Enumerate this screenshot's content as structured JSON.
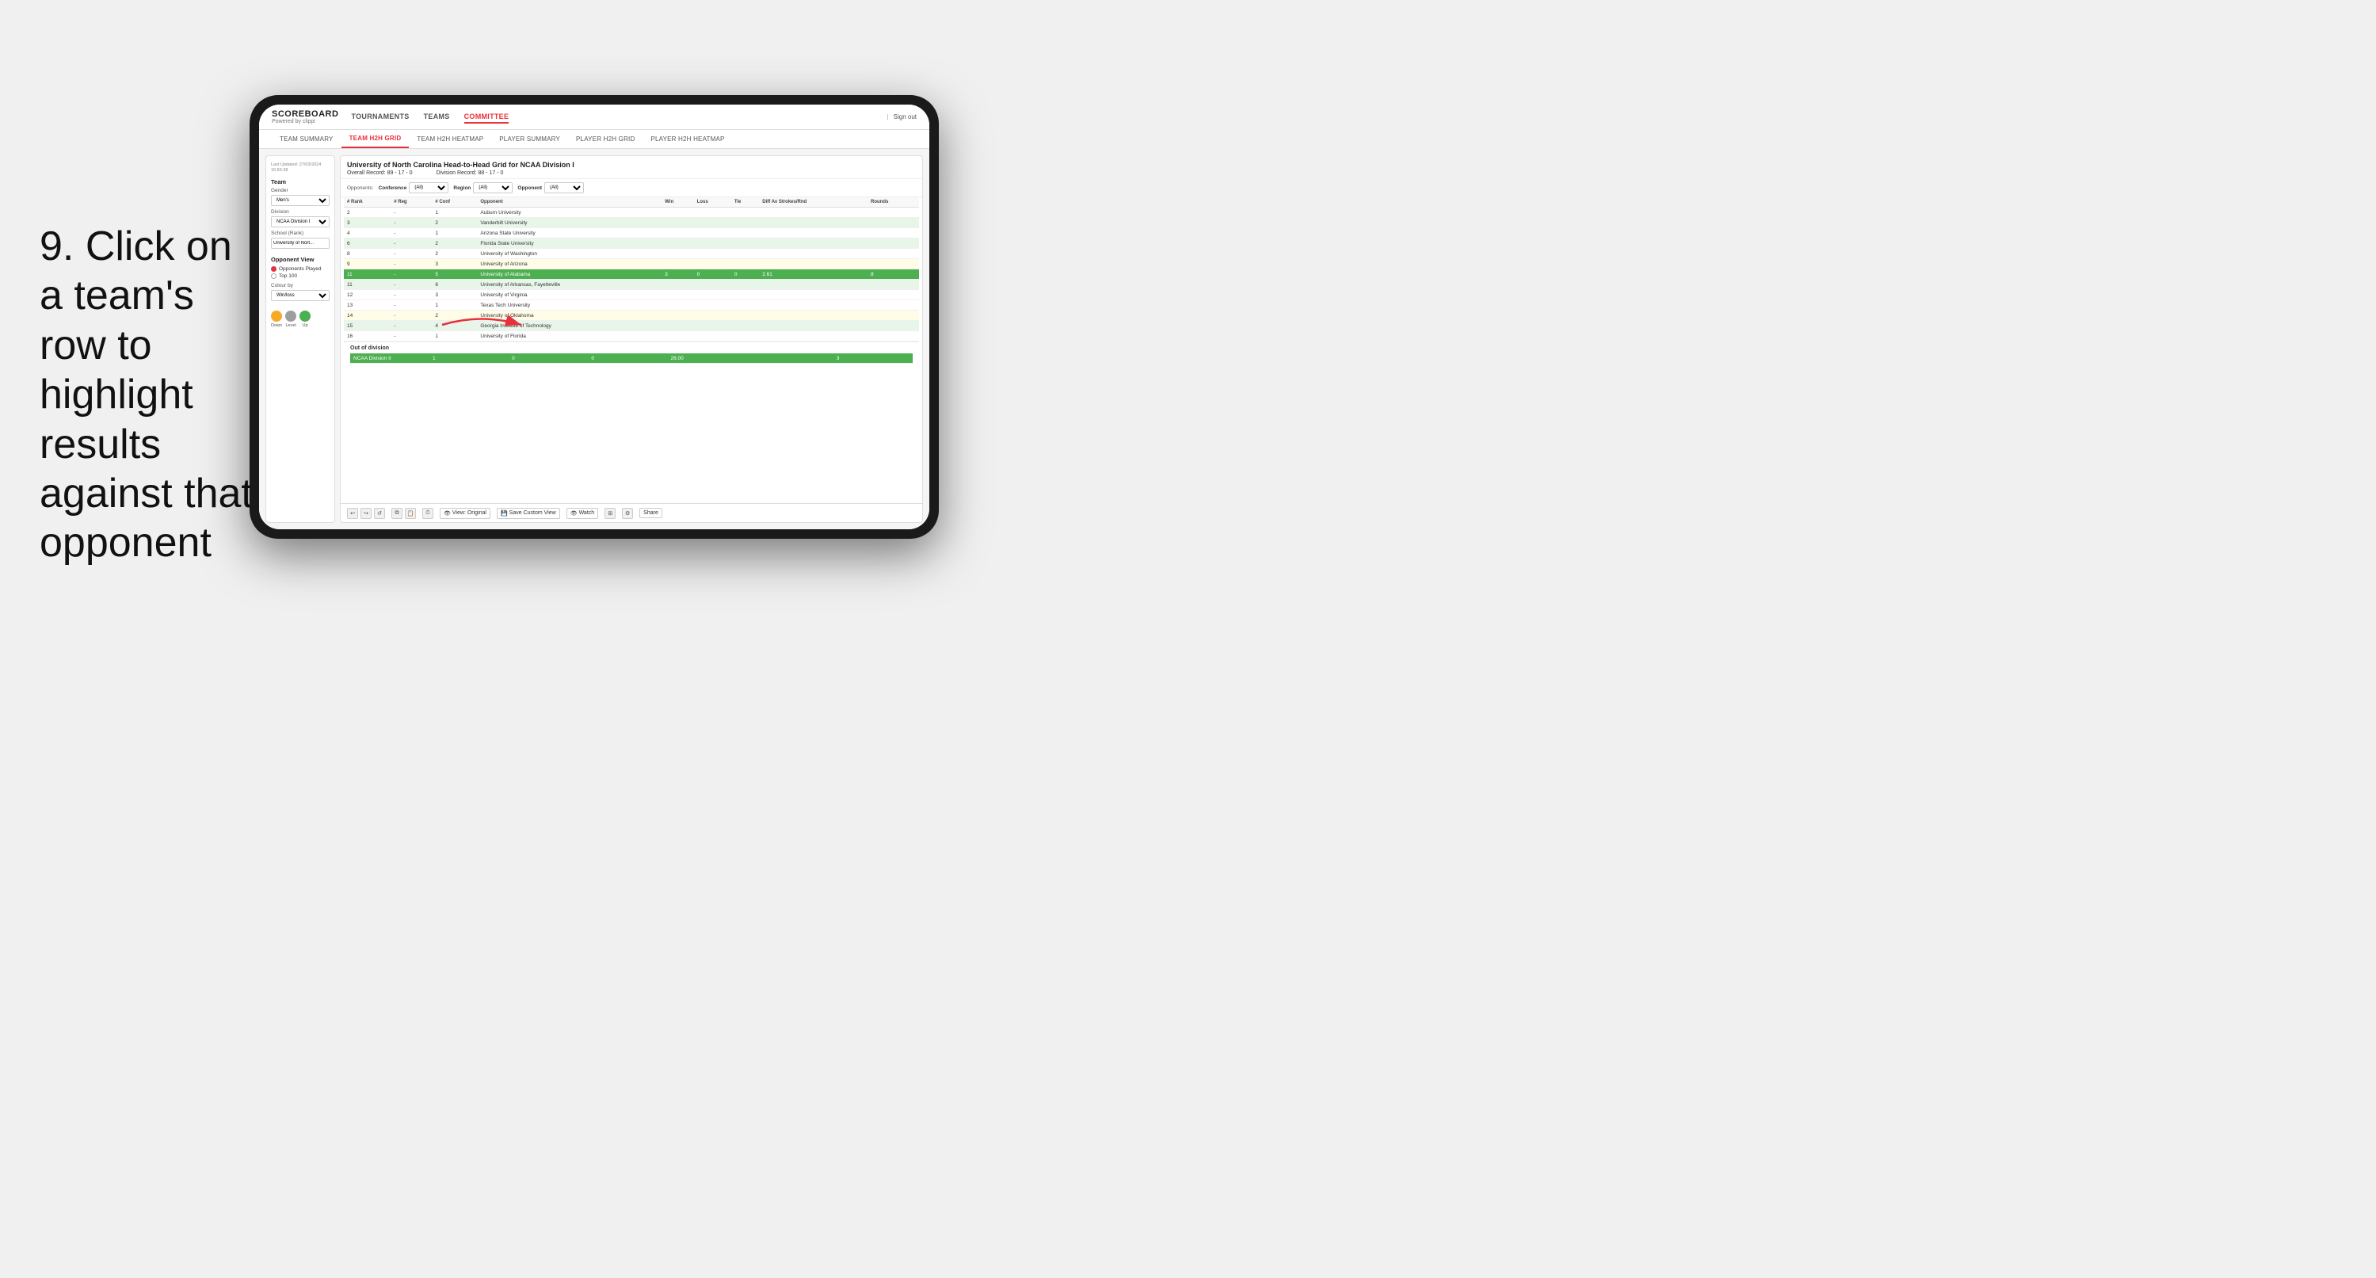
{
  "instruction": {
    "step": "9.",
    "text": "Click on a team's row to highlight results against that opponent"
  },
  "nav": {
    "logo": "SCOREBOARD",
    "logo_sub": "Powered by clippi",
    "items": [
      "TOURNAMENTS",
      "TEAMS",
      "COMMITTEE"
    ],
    "sign_out": "Sign out"
  },
  "sub_nav": {
    "items": [
      "TEAM SUMMARY",
      "TEAM H2H GRID",
      "TEAM H2H HEATMAP",
      "PLAYER SUMMARY",
      "PLAYER H2H GRID",
      "PLAYER H2H HEATMAP"
    ],
    "active": "TEAM H2H GRID"
  },
  "left_panel": {
    "timestamp_label": "Last Updated: 27/03/2024",
    "timestamp_time": "16:55:38",
    "team_label": "Team",
    "gender_label": "Gender",
    "gender_value": "Men's",
    "division_label": "Division",
    "division_value": "NCAA Division I",
    "school_label": "School (Rank)",
    "school_value": "University of Nort...",
    "opponent_view_label": "Opponent View",
    "opponent_options": [
      "Opponents Played",
      "Top 100"
    ],
    "opponent_selected": "Opponents Played",
    "colour_by_label": "Colour by",
    "colour_by_value": "Win/loss",
    "legend": [
      {
        "label": "Down",
        "color": "#f9a825"
      },
      {
        "label": "Level",
        "color": "#9e9e9e"
      },
      {
        "label": "Up",
        "color": "#4caf50"
      }
    ]
  },
  "main_grid": {
    "title": "University of North Carolina Head-to-Head Grid for NCAA Division I",
    "overall_record_label": "Overall Record:",
    "overall_record": "89 - 17 - 0",
    "division_record_label": "Division Record:",
    "division_record": "88 - 17 - 0",
    "filter_opponents_label": "Opponents:",
    "filter_conf_label": "Conference",
    "filter_region_label": "Region",
    "filter_opponent_label": "Opponent",
    "filter_conf_value": "(All)",
    "filter_region_value": "(All)",
    "filter_opponent_value": "(All)",
    "columns": [
      "# Rank",
      "# Reg",
      "# Conf",
      "Opponent",
      "Win",
      "Loss",
      "Tie",
      "Diff Av Strokes/Rnd",
      "Rounds"
    ],
    "rows": [
      {
        "rank": "2",
        "reg": "-",
        "conf": "1",
        "opponent": "Auburn University",
        "win": "",
        "loss": "",
        "tie": "",
        "diff": "",
        "rounds": "",
        "style": "normal"
      },
      {
        "rank": "3",
        "reg": "-",
        "conf": "2",
        "opponent": "Vanderbilt University",
        "win": "",
        "loss": "",
        "tie": "",
        "diff": "",
        "rounds": "",
        "style": "light-green"
      },
      {
        "rank": "4",
        "reg": "-",
        "conf": "1",
        "opponent": "Arizona State University",
        "win": "",
        "loss": "",
        "tie": "",
        "diff": "",
        "rounds": "",
        "style": "normal"
      },
      {
        "rank": "6",
        "reg": "-",
        "conf": "2",
        "opponent": "Florida State University",
        "win": "",
        "loss": "",
        "tie": "",
        "diff": "",
        "rounds": "",
        "style": "light-green"
      },
      {
        "rank": "8",
        "reg": "-",
        "conf": "2",
        "opponent": "University of Washington",
        "win": "",
        "loss": "",
        "tie": "",
        "diff": "",
        "rounds": "",
        "style": "normal"
      },
      {
        "rank": "9",
        "reg": "-",
        "conf": "3",
        "opponent": "University of Arizona",
        "win": "",
        "loss": "",
        "tie": "",
        "diff": "",
        "rounds": "",
        "style": "light-yellow"
      },
      {
        "rank": "11",
        "reg": "-",
        "conf": "5",
        "opponent": "University of Alabama",
        "win": "3",
        "loss": "0",
        "tie": "0",
        "diff": "2.61",
        "rounds": "8",
        "style": "highlighted"
      },
      {
        "rank": "11",
        "reg": "-",
        "conf": "6",
        "opponent": "University of Arkansas, Fayetteville",
        "win": "",
        "loss": "",
        "tie": "",
        "diff": "",
        "rounds": "",
        "style": "light-green"
      },
      {
        "rank": "12",
        "reg": "-",
        "conf": "3",
        "opponent": "University of Virginia",
        "win": "",
        "loss": "",
        "tie": "",
        "diff": "",
        "rounds": "",
        "style": "normal"
      },
      {
        "rank": "13",
        "reg": "-",
        "conf": "1",
        "opponent": "Texas Tech University",
        "win": "",
        "loss": "",
        "tie": "",
        "diff": "",
        "rounds": "",
        "style": "normal"
      },
      {
        "rank": "14",
        "reg": "-",
        "conf": "2",
        "opponent": "University of Oklahoma",
        "win": "",
        "loss": "",
        "tie": "",
        "diff": "",
        "rounds": "",
        "style": "light-yellow"
      },
      {
        "rank": "15",
        "reg": "-",
        "conf": "4",
        "opponent": "Georgia Institute of Technology",
        "win": "",
        "loss": "",
        "tie": "",
        "diff": "",
        "rounds": "",
        "style": "light-green"
      },
      {
        "rank": "16",
        "reg": "-",
        "conf": "1",
        "opponent": "University of Florida",
        "win": "",
        "loss": "",
        "tie": "",
        "diff": "",
        "rounds": "",
        "style": "normal"
      }
    ],
    "out_of_division": {
      "title": "Out of division",
      "row": {
        "label": "NCAA Division II",
        "win": "1",
        "loss": "0",
        "tie": "0",
        "diff": "26.00",
        "rounds": "3"
      }
    }
  },
  "toolbar": {
    "buttons": [
      "View: Original",
      "Save Custom View",
      "Watch",
      "Share"
    ]
  }
}
